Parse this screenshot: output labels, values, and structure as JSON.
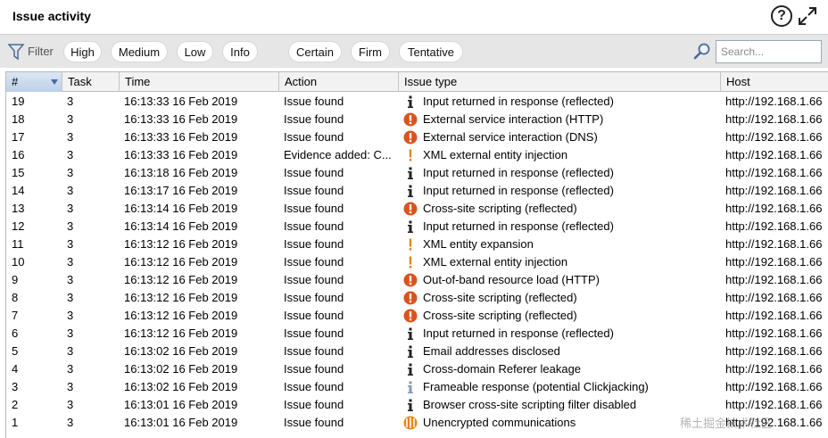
{
  "window": {
    "title": "Issue activity"
  },
  "toolbar": {
    "filter_label": "Filter",
    "severity_filters": [
      "High",
      "Medium",
      "Low",
      "Info"
    ],
    "confidence_filters": [
      "Certain",
      "Firm",
      "Tentative"
    ],
    "search_placeholder": "Search..."
  },
  "columns": [
    "#",
    "Task",
    "Time",
    "Action",
    "Issue type",
    "Host"
  ],
  "sort": {
    "column": "#",
    "direction": "descending"
  },
  "colors": {
    "high": "#d9531e",
    "medium": "#e8860c",
    "info": "#222222",
    "info_low": "#8a9ab0"
  },
  "rows": [
    {
      "num": "19",
      "task": "3",
      "time": "16:13:33 16 Feb 2019",
      "action": "Issue found",
      "issue_type": "Input returned in response (reflected)",
      "icon": "info-icon",
      "host": "http://192.168.1.66"
    },
    {
      "num": "18",
      "task": "3",
      "time": "16:13:33 16 Feb 2019",
      "action": "Issue found",
      "issue_type": "External service interaction (HTTP)",
      "icon": "high-severity-icon",
      "host": "http://192.168.1.66"
    },
    {
      "num": "17",
      "task": "3",
      "time": "16:13:33 16 Feb 2019",
      "action": "Issue found",
      "issue_type": "External service interaction (DNS)",
      "icon": "high-severity-icon",
      "host": "http://192.168.1.66"
    },
    {
      "num": "16",
      "task": "3",
      "time": "16:13:33 16 Feb 2019",
      "action": "Evidence added: C...",
      "issue_type": "XML external entity injection",
      "icon": "tentative-icon",
      "host": "http://192.168.1.66"
    },
    {
      "num": "15",
      "task": "3",
      "time": "16:13:18 16 Feb 2019",
      "action": "Issue found",
      "issue_type": "Input returned in response (reflected)",
      "icon": "info-icon",
      "host": "http://192.168.1.66"
    },
    {
      "num": "14",
      "task": "3",
      "time": "16:13:17 16 Feb 2019",
      "action": "Issue found",
      "issue_type": "Input returned in response (reflected)",
      "icon": "info-icon",
      "host": "http://192.168.1.66"
    },
    {
      "num": "13",
      "task": "3",
      "time": "16:13:14 16 Feb 2019",
      "action": "Issue found",
      "issue_type": "Cross-site scripting (reflected)",
      "icon": "high-severity-icon",
      "host": "http://192.168.1.66"
    },
    {
      "num": "12",
      "task": "3",
      "time": "16:13:14 16 Feb 2019",
      "action": "Issue found",
      "issue_type": "Input returned in response (reflected)",
      "icon": "info-icon",
      "host": "http://192.168.1.66"
    },
    {
      "num": "11",
      "task": "3",
      "time": "16:13:12 16 Feb 2019",
      "action": "Issue found",
      "issue_type": "XML entity expansion",
      "icon": "tentative-icon",
      "host": "http://192.168.1.66"
    },
    {
      "num": "10",
      "task": "3",
      "time": "16:13:12 16 Feb 2019",
      "action": "Issue found",
      "issue_type": "XML external entity injection",
      "icon": "tentative-icon",
      "host": "http://192.168.1.66"
    },
    {
      "num": "9",
      "task": "3",
      "time": "16:13:12 16 Feb 2019",
      "action": "Issue found",
      "issue_type": "Out-of-band resource load (HTTP)",
      "icon": "high-severity-icon",
      "host": "http://192.168.1.66"
    },
    {
      "num": "8",
      "task": "3",
      "time": "16:13:12 16 Feb 2019",
      "action": "Issue found",
      "issue_type": "Cross-site scripting (reflected)",
      "icon": "high-severity-icon",
      "host": "http://192.168.1.66"
    },
    {
      "num": "7",
      "task": "3",
      "time": "16:13:12 16 Feb 2019",
      "action": "Issue found",
      "issue_type": "Cross-site scripting (reflected)",
      "icon": "high-severity-icon",
      "host": "http://192.168.1.66"
    },
    {
      "num": "6",
      "task": "3",
      "time": "16:13:12 16 Feb 2019",
      "action": "Issue found",
      "issue_type": "Input returned in response (reflected)",
      "icon": "info-icon",
      "host": "http://192.168.1.66"
    },
    {
      "num": "5",
      "task": "3",
      "time": "16:13:02 16 Feb 2019",
      "action": "Issue found",
      "issue_type": "Email addresses disclosed",
      "icon": "info-icon",
      "host": "http://192.168.1.66"
    },
    {
      "num": "4",
      "task": "3",
      "time": "16:13:02 16 Feb 2019",
      "action": "Issue found",
      "issue_type": "Cross-domain Referer leakage",
      "icon": "info-icon",
      "host": "http://192.168.1.66"
    },
    {
      "num": "3",
      "task": "3",
      "time": "16:13:02 16 Feb 2019",
      "action": "Issue found",
      "issue_type": "Frameable response (potential Clickjacking)",
      "icon": "info-light-icon",
      "host": "http://192.168.1.66"
    },
    {
      "num": "2",
      "task": "3",
      "time": "16:13:01 16 Feb 2019",
      "action": "Issue found",
      "issue_type": "Browser cross-site scripting filter disabled",
      "icon": "info-icon",
      "host": "http://192.168.1.66"
    },
    {
      "num": "1",
      "task": "3",
      "time": "16:13:01 16 Feb 2019",
      "action": "Issue found",
      "issue_type": "Unencrypted communications",
      "icon": "medium-severity-icon",
      "host": "http://192.168.1.66"
    }
  ],
  "watermark": "稀土掘金技术社区"
}
